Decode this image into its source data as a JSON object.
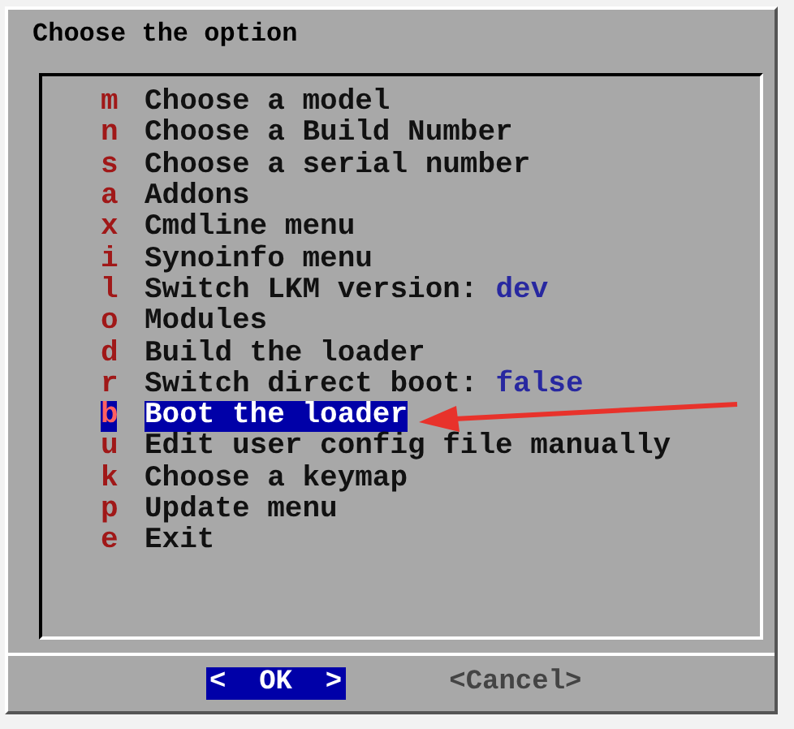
{
  "dialog": {
    "title": "Choose the option"
  },
  "menu": [
    {
      "key": "m",
      "label": "Choose a model",
      "selected": false
    },
    {
      "key": "n",
      "label": "Choose a Build Number",
      "selected": false
    },
    {
      "key": "s",
      "label": "Choose a serial number",
      "selected": false
    },
    {
      "key": "a",
      "label": "Addons",
      "selected": false
    },
    {
      "key": "x",
      "label": "Cmdline menu",
      "selected": false
    },
    {
      "key": "i",
      "label": "Synoinfo menu",
      "selected": false
    },
    {
      "key": "l",
      "label": "Switch LKM version:",
      "value": "dev",
      "selected": false
    },
    {
      "key": "o",
      "label": "Modules",
      "selected": false
    },
    {
      "key": "d",
      "label": "Build the loader",
      "selected": false
    },
    {
      "key": "r",
      "label": "Switch direct boot:",
      "value": "false",
      "selected": false
    },
    {
      "key": "b",
      "label": "Boot the loader",
      "selected": true
    },
    {
      "key": "u",
      "label": "Edit user config file manually",
      "selected": false
    },
    {
      "key": "k",
      "label": "Choose a keymap",
      "selected": false
    },
    {
      "key": "p",
      "label": "Update menu",
      "selected": false
    },
    {
      "key": "e",
      "label": "Exit",
      "selected": false
    }
  ],
  "buttons": [
    {
      "label": "<  OK  >",
      "selected": true
    },
    {
      "label": "<Cancel>",
      "selected": false
    }
  ]
}
